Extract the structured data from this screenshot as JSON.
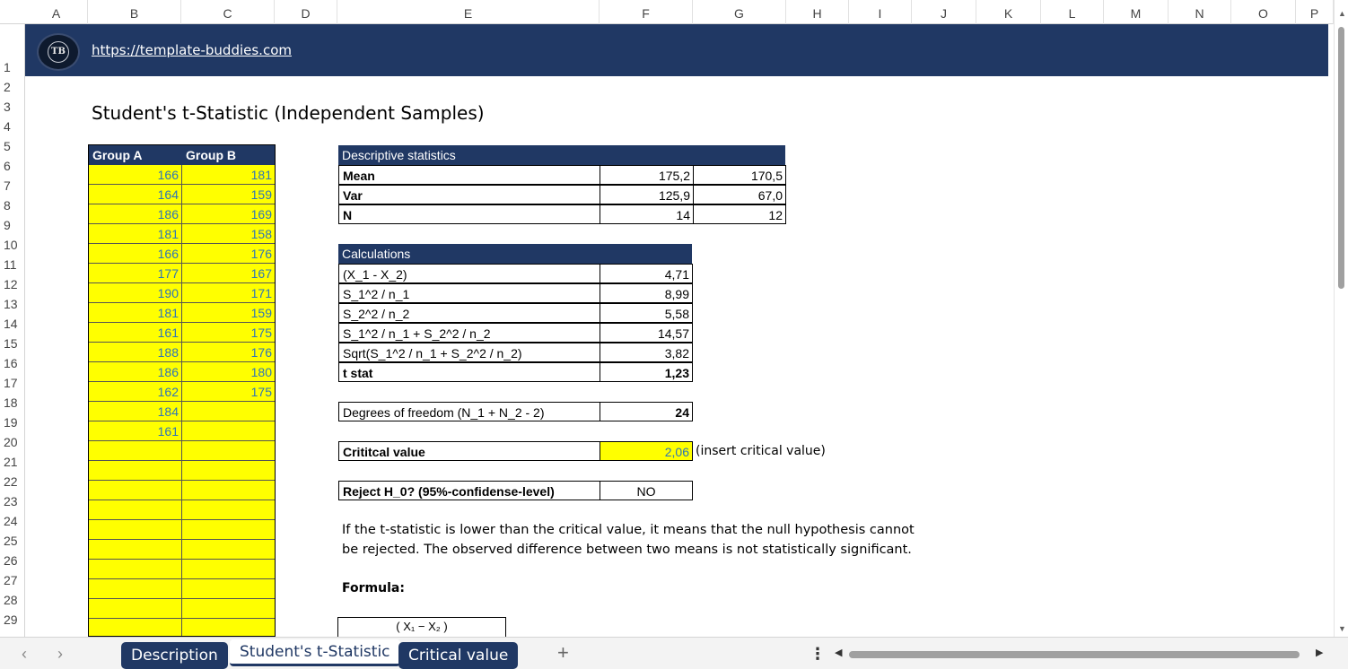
{
  "columns": [
    "A",
    "B",
    "C",
    "D",
    "E",
    "F",
    "G",
    "H",
    "I",
    "J",
    "K",
    "L",
    "M",
    "N",
    "O",
    "P"
  ],
  "rows": [
    "1",
    "2",
    "3",
    "4",
    "5",
    "6",
    "7",
    "8",
    "9",
    "10",
    "11",
    "12",
    "13",
    "14",
    "15",
    "16",
    "17",
    "18",
    "19",
    "20",
    "21",
    "22",
    "23",
    "24",
    "25",
    "26",
    "27",
    "28",
    "29"
  ],
  "banner": {
    "logo_text": "TB",
    "link": "https://template-buddies.com"
  },
  "title": "Student's t-Statistic (Independent Samples)",
  "groups": {
    "header_a": "Group A",
    "header_b": "Group B",
    "values_a": [
      "166",
      "164",
      "186",
      "181",
      "166",
      "177",
      "190",
      "181",
      "161",
      "188",
      "186",
      "162",
      "184",
      "161"
    ],
    "values_b": [
      "181",
      "159",
      "169",
      "158",
      "176",
      "167",
      "171",
      "159",
      "175",
      "176",
      "180",
      "175"
    ]
  },
  "descriptive": {
    "header": "Descriptive statistics",
    "rows": [
      {
        "label": "Mean",
        "a": "175,2",
        "b": "170,5"
      },
      {
        "label": "Var",
        "a": "125,9",
        "b": "67,0"
      },
      {
        "label": "N",
        "a": "14",
        "b": "12"
      }
    ]
  },
  "calculations": {
    "header": "Calculations",
    "rows": [
      {
        "label": "(X_1 - X_2)",
        "value": "4,71"
      },
      {
        "label": "S_1^2 / n_1",
        "value": "8,99"
      },
      {
        "label": "S_2^2 / n_2",
        "value": "5,58"
      },
      {
        "label": "S_1^2 / n_1 + S_2^2 / n_2",
        "value": "14,57"
      },
      {
        "label": "Sqrt(S_1^2 / n_1 + S_2^2 / n_2)",
        "value": "3,82"
      },
      {
        "label": "t stat",
        "value": "1,23"
      }
    ]
  },
  "dof": {
    "label": "Degrees of freedom (N_1 + N_2 - 2)",
    "value": "24"
  },
  "critical": {
    "label": "Crititcal value",
    "value": "2,06",
    "hint": "(insert critical value)"
  },
  "reject": {
    "label": "Reject H_0? (95%-confidense-level)",
    "value": "NO"
  },
  "note": "If the t-statistic is lower than the critical value, it means that the null hypothesis cannot be rejected. The observed difference between two means is not statistically significant.",
  "formula_label": "Formula:",
  "formula_text": "( X₁ − X₂ )",
  "tabs": [
    "Description",
    "Student's t-Statistic",
    "Critical value"
  ],
  "active_tab": 1,
  "add_tab": "+",
  "more_menu": "⋮",
  "colors": {
    "navy": "#203864",
    "yellow": "#ffff00",
    "input_blue": "#2e75b6"
  }
}
